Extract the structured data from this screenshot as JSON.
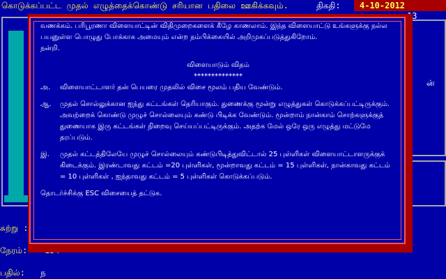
{
  "header": {
    "hint": "கொடுக்கப்பட்ட முதல் எழுத்தைக்கொண்டு சரியான பதிலை ஊகிக்கவும்.",
    "date_label": "திகதி:",
    "date_value": "4-10-2012"
  },
  "corner_number": "13",
  "right_glyph": "ன்",
  "rows": {
    "clue_label": "சுற்று :",
    "time_label": "நேரம்:",
    "time_value": "134",
    "answer_label": "பதில்:",
    "answer_value": "ந"
  },
  "dialog": {
    "intro": "வணக்கம். பரிபூரணா விளையாட்டின் விதிமுறைகளைக் கீழே காணலாம். இந்த விளையாட்டு உங்களுக்கு நல்ல பயனுள்ள பொழுது போக்காக அமையும் என்ற நம்பிக்கையில் அறிமுகப்படுத்துகிறோம்.",
    "thanks": "நன்றி.",
    "heading": "விளையாடும் விதம்",
    "stars": "**************",
    "rules": [
      {
        "bullet": "அ.",
        "text": "விளையாட்டாளர் தன் பெயரை முதலில் விசை மூலம் பதிய வேண்டும்."
      },
      {
        "bullet": "ஆ.",
        "text": "முதல் சொல்லுக்கான ஐந்து கட்டங்கள் தெரியாகும். துணைக்கு மூன்று எழுத்துகள் கொடுக்கப்பட்டிருக்கும். அவற்றைக் கொண்டு முழுச் சொல்லையும் கண்டு பிடிக்க வேண்டும். மூன்றாம் நான்காம் சொற்களுக்குத் துணையாக இரு கட்டங்கள் நிறைவு செய்யப்பட்டிருக்கும். அதற்க மேல் ஒரே ஒரு எழுத்து மட்டுமே தரப்படும்."
      },
      {
        "bullet": "இ.",
        "text": "முதல் கட்டத்திலேயே முழுச் சொல்லையும் கண்டுபிடித்துவிட்டால் 25 புள்ளிகள் விளையாட்டாளருக்குக் கிடைக்கும். இரண்டாவது கட்டம் =20 புள்ளிகள், மூன்றாவது கட்டம் = 15 புள்ளிகள், நான்காவது கட்டம் = 10 புள்ளிகள் , ஐந்தாவது கட்டம் = 5 புள்ளிகள் கொடுக்கப்படும்."
      }
    ],
    "footer": "தொடர்ச்சிக்கு ESC விசையைத் தட்டுக."
  },
  "colors": {
    "background": "#0000a8",
    "accent_red": "#a80000",
    "text_yellow": "#fcfc54",
    "cyan": "#00a8a8"
  }
}
